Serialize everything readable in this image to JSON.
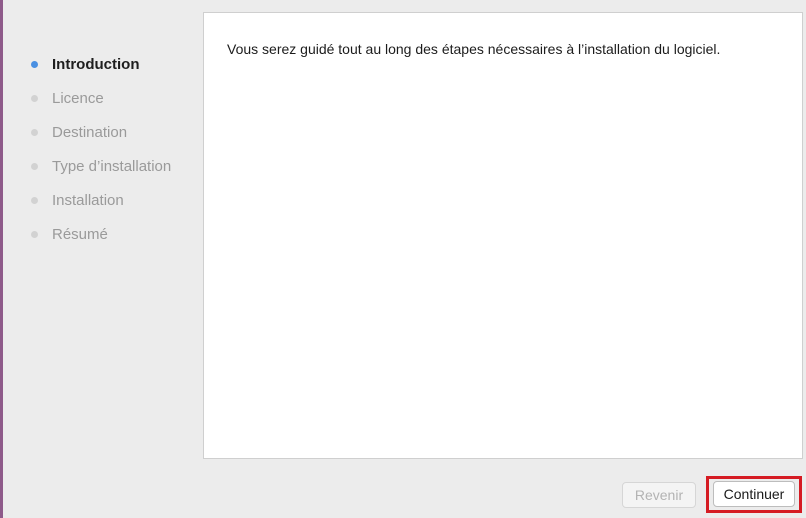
{
  "installer": {
    "steps": [
      {
        "label": "Introduction",
        "active": true
      },
      {
        "label": "Licence",
        "active": false
      },
      {
        "label": "Destination",
        "active": false
      },
      {
        "label": "Type d’installation",
        "active": false
      },
      {
        "label": "Installation",
        "active": false
      },
      {
        "label": "Résumé",
        "active": false
      }
    ],
    "content": {
      "intro_text": "Vous serez guidé tout au long des étapes nécessaires à l’installation du logiciel."
    },
    "buttons": {
      "back_label": "Revenir",
      "continue_label": "Continuer"
    },
    "colors": {
      "active_dot": "#4a90e2",
      "inactive_dot": "#d2d2d2",
      "highlight_box": "#d51b23",
      "window_edge": "#8e5a8a"
    }
  }
}
